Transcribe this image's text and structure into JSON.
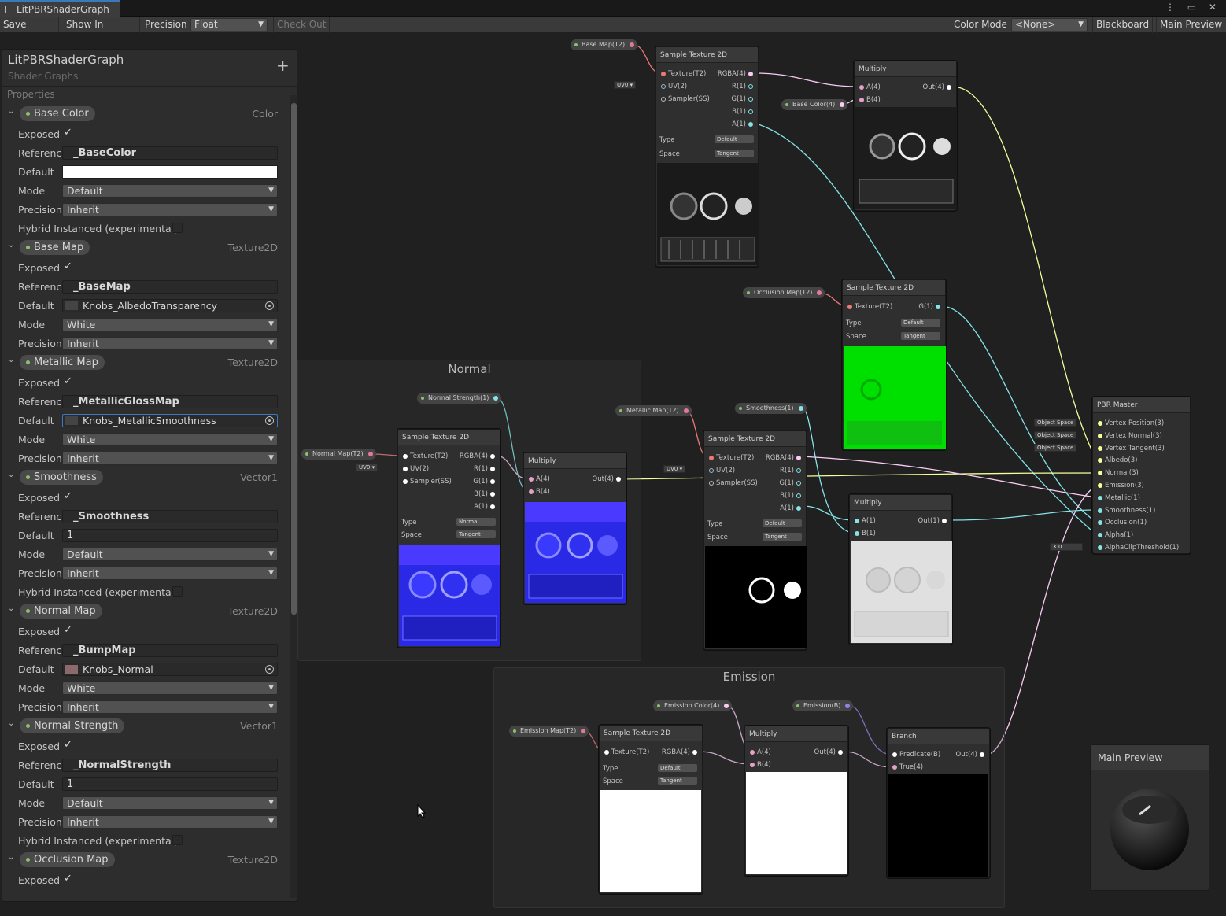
{
  "window": {
    "tab_title": "LitPBRShaderGraph",
    "controls": "⋮ ▭ ✕"
  },
  "toolbar": {
    "save_asset": "Save Asset",
    "show_in_project": "Show In Project",
    "precision_label": "Precision",
    "precision_value": "Float",
    "check_out": "Check Out",
    "color_mode_label": "Color Mode",
    "color_mode_value": "<None>",
    "blackboard": "Blackboard",
    "main_preview": "Main Preview"
  },
  "blackboard": {
    "title": "LitPBRShaderGraph",
    "subtitle": "Shader Graphs",
    "add": "+",
    "section": "Properties",
    "properties": [
      {
        "name": "Base Color",
        "type": "Color",
        "exposed": "✓",
        "reference": "_BaseColor",
        "mode": "Default",
        "precision": "Inherit",
        "hybrid": "Hybrid Instanced (experimental)"
      },
      {
        "name": "Base Map",
        "type": "Texture2D",
        "exposed": "✓",
        "reference": "_BaseMap",
        "default": "Knobs_AlbedoTransparency",
        "mode": "White",
        "precision": "Inherit"
      },
      {
        "name": "Metallic Map",
        "type": "Texture2D",
        "exposed": "✓",
        "reference": "_MetallicGlossMap",
        "default": "Knobs_MetallicSmoothness",
        "mode": "White",
        "precision": "Inherit"
      },
      {
        "name": "Smoothness",
        "type": "Vector1",
        "exposed": "✓",
        "reference": "_Smoothness",
        "default": "1",
        "mode": "Default",
        "precision": "Inherit",
        "hybrid": "Hybrid Instanced (experimental)"
      },
      {
        "name": "Normal Map",
        "type": "Texture2D",
        "exposed": "✓",
        "reference": "_BumpMap",
        "default": "Knobs_Normal",
        "mode": "White",
        "precision": "Inherit"
      },
      {
        "name": "Normal Strength",
        "type": "Vector1",
        "exposed": "✓",
        "reference": "_NormalStrength",
        "default": "1",
        "mode": "Default",
        "precision": "Inherit",
        "hybrid": "Hybrid Instanced (experimental)"
      },
      {
        "name": "Occlusion Map",
        "type": "Texture2D",
        "exposed": "✓"
      }
    ],
    "labels": {
      "exposed": "Exposed",
      "reference": "Reference",
      "default": "Default",
      "mode": "Mode",
      "precision": "Precision"
    }
  },
  "groups": {
    "normal": "Normal",
    "emission": "Emission"
  },
  "property_nodes": {
    "base_map": "Base Map(T2)",
    "base_color": "Base Color(4)",
    "occlusion_map": "Occlusion Map(T2)",
    "normal_strength": "Normal Strength(1)",
    "normal_map": "Normal Map(T2)",
    "metallic_map": "Metallic Map(T2)",
    "smoothness": "Smoothness(1)",
    "emission_color": "Emission Color(4)",
    "emission": "Emission(B)",
    "emission_map": "Emission Map(T2)"
  },
  "uv": {
    "label": "UV0"
  },
  "nodes": {
    "sample": {
      "title": "Sample Texture 2D",
      "texture": "Texture(T2)",
      "uv": "UV(2)",
      "sampler": "Sampler(SS)",
      "rgba": "RGBA(4)",
      "r": "R(1)",
      "g": "G(1)",
      "b": "B(1)",
      "a": "A(1)",
      "type": "Type",
      "space": "Space",
      "default": "Default",
      "normal": "Normal",
      "tangent": "Tangent"
    },
    "multiply": {
      "title": "Multiply",
      "a4": "A(4)",
      "b4": "B(4)",
      "out4": "Out(4)",
      "a1": "A(1)",
      "b1": "B(1)",
      "out1": "Out(1)"
    },
    "branch": {
      "title": "Branch",
      "predicate": "Predicate(B)",
      "true": "True(4)",
      "out": "Out(4)"
    },
    "master": {
      "title": "PBR Master",
      "ports": [
        "Vertex Position(3)",
        "Vertex Normal(3)",
        "Vertex Tangent(3)",
        "Albedo(3)",
        "Normal(3)",
        "Emission(3)",
        "Metallic(1)",
        "Smoothness(1)",
        "Occlusion(1)",
        "Alpha(1)",
        "AlphaClipThreshold(1)"
      ],
      "object_space": "Object Space",
      "x_label": "X",
      "x_value": "0"
    }
  },
  "preview": {
    "title": "Main Preview"
  },
  "colors": {
    "accent": "#3a79bb",
    "vec1": "#84e4e7",
    "vec3": "#f6ff9a",
    "vec4": "#fbcbf4",
    "texture": "#ff8b8b",
    "bool": "#9481e6"
  }
}
